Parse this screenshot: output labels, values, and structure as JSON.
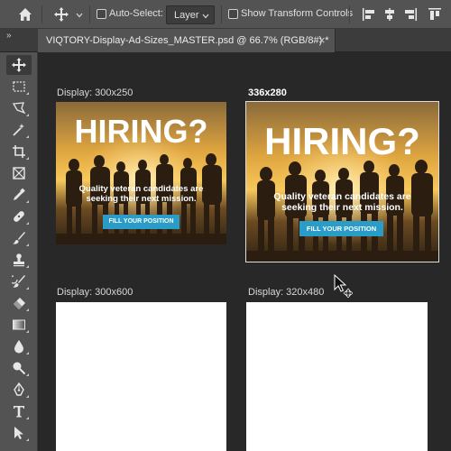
{
  "options_bar": {
    "auto_select_label": "Auto-Select:",
    "auto_select_value": "Layer",
    "show_transform_label": "Show Transform Controls"
  },
  "document": {
    "tab_title": "VIQTORY-Display-Ad-Sizes_MASTER.psd @ 66.7% (RGB/8#) *",
    "close_symbol": "×"
  },
  "artboards": [
    {
      "label": "Display: 300x250",
      "ad": {
        "headline": "HIRING?",
        "tagline_1": "Quality veteran candidates are",
        "tagline_2": "seeking their next mission.",
        "cta": "FILL YOUR POSITION"
      }
    },
    {
      "label": "336x280",
      "ad": {
        "headline": "HIRING?",
        "tagline_1": "Quality veteran candidates are",
        "tagline_2": "seeking their next mission.",
        "cta": "FILL YOUR POSITION"
      }
    },
    {
      "label": "Display: 300x600"
    },
    {
      "label": "Display: 320x480"
    }
  ],
  "colors": {
    "cta_blue": "#2a9cc8",
    "ui_panel": "#535353",
    "canvas_bg": "#282828"
  },
  "tools": [
    "move-tool-icon",
    "marquee-tool-icon",
    "lasso-tool-icon",
    "magic-wand-tool-icon",
    "crop-tool-icon",
    "frame-tool-icon",
    "eyedropper-tool-icon",
    "healing-brush-tool-icon",
    "brush-tool-icon",
    "clone-stamp-tool-icon",
    "history-brush-tool-icon",
    "eraser-tool-icon",
    "gradient-tool-icon",
    "blur-tool-icon",
    "dodge-tool-icon",
    "pen-tool-icon",
    "type-tool-icon",
    "path-selection-tool-icon"
  ]
}
